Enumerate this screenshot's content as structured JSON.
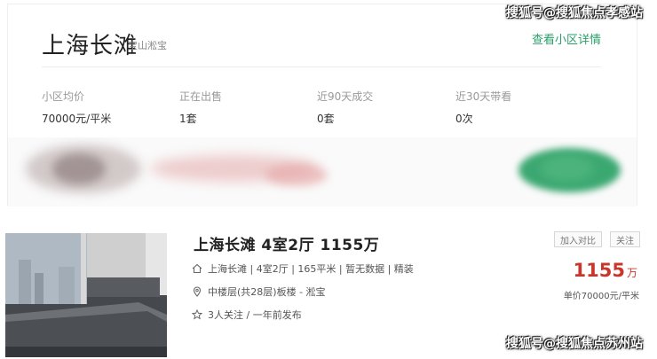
{
  "watermarks": {
    "top": "搜狐号@搜狐焦点孝感站",
    "bottom": "搜狐号@搜狐焦点苏州站"
  },
  "community": {
    "name": "上海长滩",
    "district": "宝山淞宝",
    "details_link": "查看小区详情",
    "stats": [
      {
        "label": "小区均价",
        "value": "70000元/平米"
      },
      {
        "label": "正在出售",
        "value": "1套"
      },
      {
        "label": "近90天成交",
        "value": "0套"
      },
      {
        "label": "近30天带看",
        "value": "0次"
      }
    ]
  },
  "listing": {
    "title": "上海长滩 4室2厅 1155万",
    "features": "上海长滩 | 4室2厅 | 165平米 | 暂无数据 | 精装",
    "location": "中楼层(共28层)板楼 - 淞宝",
    "followers": "3人关注 / 一年前发布",
    "compare_button": "加入对比",
    "follow_button": "关注",
    "price_value": "1155",
    "price_unit": "万",
    "unit_price": "单价70000元/平米",
    "icons": [
      "home-icon",
      "location-pin-icon",
      "star-icon"
    ]
  },
  "colors": {
    "link_green": "#2a9f6a",
    "price_red": "#c8372b"
  }
}
